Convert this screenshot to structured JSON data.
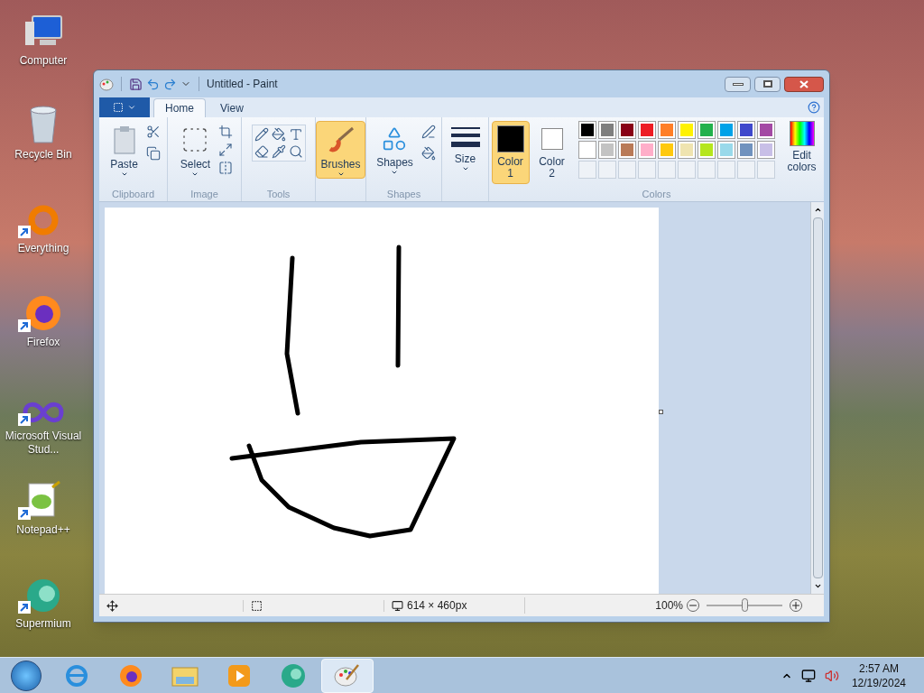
{
  "desktop_icons": [
    {
      "label": "Computer",
      "kind": "computer",
      "shortcut": false
    },
    {
      "label": "Recycle Bin",
      "kind": "bin",
      "shortcut": false
    },
    {
      "label": "Everything",
      "kind": "ring",
      "shortcut": true
    },
    {
      "label": "Firefox",
      "kind": "fox",
      "shortcut": true
    },
    {
      "label": "Microsoft Visual Stud...",
      "kind": "infinity",
      "shortcut": true
    },
    {
      "label": "Notepad++",
      "kind": "notepad",
      "shortcut": true
    },
    {
      "label": "Supermium",
      "kind": "sphere",
      "shortcut": true
    }
  ],
  "window": {
    "title": "Untitled - Paint",
    "tabs": [
      {
        "label": "Home",
        "selected": true
      },
      {
        "label": "View",
        "selected": false
      }
    ],
    "ribbon": {
      "clipboard": {
        "paste": "Paste",
        "label": "Clipboard"
      },
      "image": {
        "select": "Select",
        "label": "Image"
      },
      "tools": {
        "label": "Tools"
      },
      "brushes": {
        "label": "Brushes",
        "selected": true
      },
      "shapes": {
        "button": "Shapes",
        "label": "Shapes"
      },
      "size": {
        "label": "Size"
      },
      "colors": {
        "color1": {
          "label": "Color 1",
          "color": "#000000",
          "selected": true
        },
        "color2": {
          "label": "Color 2",
          "color": "#ffffff",
          "selected": false
        },
        "palette": [
          {
            "color": "#000000"
          },
          {
            "color": "#7f7f7f"
          },
          {
            "color": "#880015"
          },
          {
            "color": "#ed1c24"
          },
          {
            "color": "#ff7f27"
          },
          {
            "color": "#fff200"
          },
          {
            "color": "#22b14c"
          },
          {
            "color": "#00a2e8"
          },
          {
            "color": "#3f48cc"
          },
          {
            "color": "#a349a4"
          },
          {
            "color": "#ffffff"
          },
          {
            "color": "#c3c3c3"
          },
          {
            "color": "#b97a57"
          },
          {
            "color": "#ffaec9"
          },
          {
            "color": "#ffc90e"
          },
          {
            "color": "#efe4b0"
          },
          {
            "color": "#b5e61d"
          },
          {
            "color": "#99d9ea"
          },
          {
            "color": "#7092be"
          },
          {
            "color": "#c8bfe7"
          }
        ],
        "edit": "Edit colors",
        "label": "Colors"
      }
    },
    "status_bar": {
      "dimensions": "614 × 460px",
      "zoom": "100%",
      "zoom_slider": {
        "level": 0.5
      }
    }
  },
  "taskbar": {
    "apps": [
      {
        "kind": "ie",
        "selected": false
      },
      {
        "kind": "firefox",
        "selected": false
      },
      {
        "kind": "explorer",
        "selected": false
      },
      {
        "kind": "media",
        "selected": false
      },
      {
        "kind": "sphere",
        "selected": false
      },
      {
        "kind": "paint",
        "selected": true
      }
    ],
    "time": "2:57 AM",
    "date": "12/19/2024"
  }
}
